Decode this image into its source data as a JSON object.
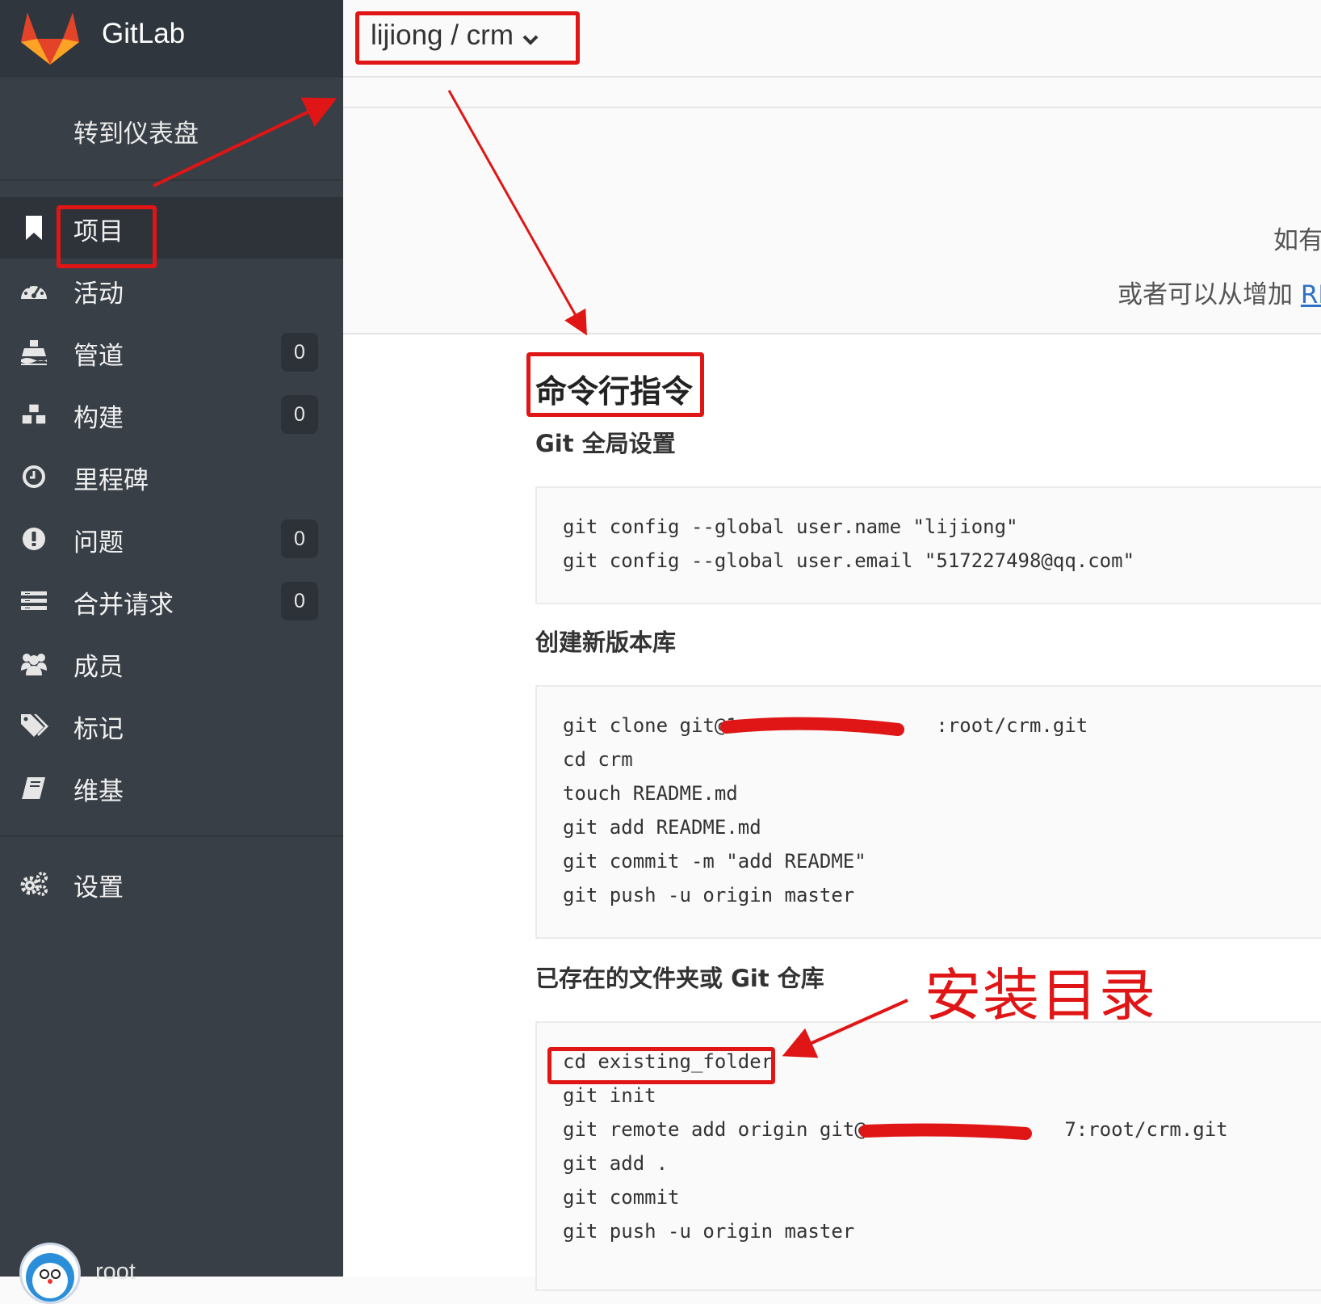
{
  "brand": {
    "title": "GitLab"
  },
  "sidebar": {
    "dashboard_link": "转到仪表盘",
    "items": [
      {
        "label": "项目",
        "icon": "bookmark-icon"
      },
      {
        "label": "活动",
        "icon": "dashboard-icon"
      },
      {
        "label": "管道",
        "icon": "ship-icon",
        "count": "0"
      },
      {
        "label": "构建",
        "icon": "cubes-icon",
        "count": "0"
      },
      {
        "label": "里程碑",
        "icon": "clock-icon"
      },
      {
        "label": "问题",
        "icon": "exclamation-icon",
        "count": "0"
      },
      {
        "label": "合并请求",
        "icon": "list-icon",
        "count": "0"
      },
      {
        "label": "成员",
        "icon": "users-icon"
      },
      {
        "label": "标记",
        "icon": "tags-icon"
      },
      {
        "label": "维基",
        "icon": "book-icon"
      }
    ],
    "settings": {
      "label": "设置",
      "icon": "gears-icon"
    },
    "user": {
      "name": "root"
    }
  },
  "header": {
    "project": "lijiong / crm"
  },
  "empty_state": {
    "line1": "如有",
    "line2": "或者可以从增加 ",
    "link": "RE"
  },
  "main": {
    "title": "命令行指令",
    "sections": [
      {
        "title": "Git 全局设置",
        "lines": [
          "git config --global user.name \"lijiong\"",
          "git config --global user.email \"517227498@qq.com\""
        ]
      },
      {
        "title": "创建新版本库",
        "lines": [
          "git clone git@1                 :root/crm.git",
          "cd crm",
          "touch README.md",
          "git add README.md",
          "git commit -m \"add README\"",
          "git push -u origin master"
        ]
      },
      {
        "title": "已存在的文件夹或 Git 仓库",
        "lines": [
          "cd existing_folder",
          "git init",
          "git remote add origin git@                 7:root/crm.git",
          "git add .",
          "git commit",
          "git push -u origin master"
        ]
      }
    ]
  },
  "annotation": {
    "label": "安装目录",
    "color": "#e01515"
  },
  "colors": {
    "sidebar": "#393f47",
    "brand_bar": "#30363e",
    "link": "#2e72c6"
  }
}
